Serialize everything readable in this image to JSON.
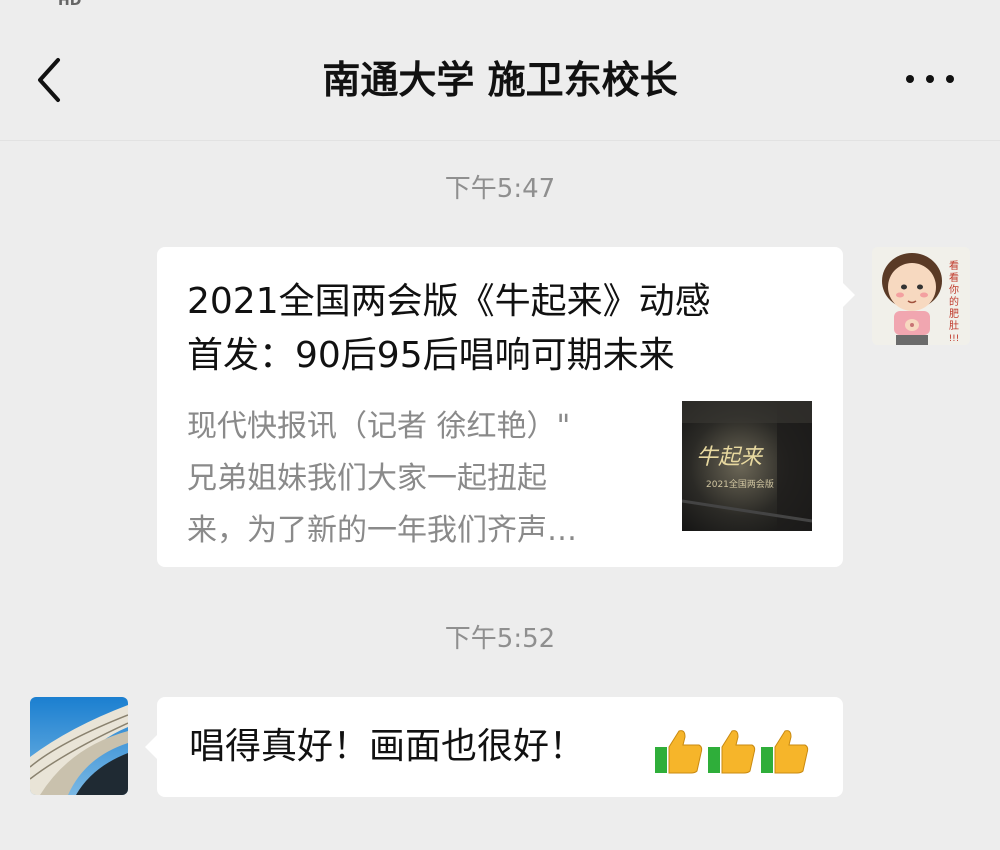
{
  "status_bar": {
    "network_badge": "HD"
  },
  "nav": {
    "title": "南通大学 施卫东校长",
    "back_icon": "chevron-left-icon",
    "more_icon": "more-dots-icon"
  },
  "messages": [
    {
      "timestamp": "下午5:47",
      "sender": "self",
      "type": "link_card",
      "title": "2021全国两会版《牛起来》动感首发：90后95后唱响可期未来",
      "title_lines": [
        "2021全国两会版《牛起来》动感",
        "首发：90后95后唱响可期未来"
      ],
      "desc_lines": [
        "现代快报讯（记者 徐红艳）\"",
        "兄弟姐妹我们大家一起扭起",
        "来，为了新的一年我们齐声…"
      ],
      "thumbnail": {
        "caption": "牛起来",
        "subcaption": "2021全国两会版"
      },
      "avatar_text": "看看你的肥肚!!!"
    },
    {
      "timestamp": "下午5:52",
      "sender": "other",
      "type": "text",
      "text": "唱得真好！画面也很好！",
      "emoji": [
        "thumbs-up-icon",
        "thumbs-up-icon",
        "thumbs-up-icon"
      ]
    }
  ],
  "colors": {
    "background": "#ededed",
    "bubble": "#ffffff",
    "timestamp": "#8f8f8f",
    "desc": "#8a8a8a",
    "thumb_green": "#2fae3a",
    "thumb_yellow": "#f6b52a"
  }
}
